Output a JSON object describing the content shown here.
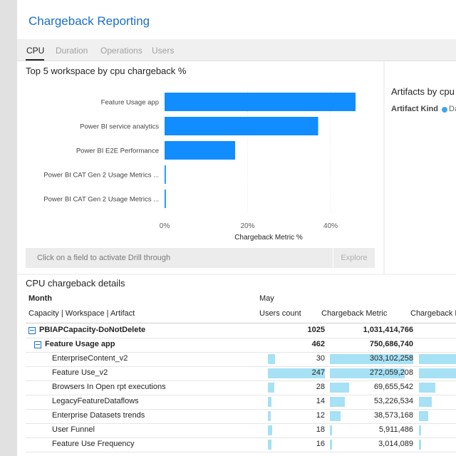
{
  "app": {
    "title": "Chargeback Reporting"
  },
  "tabs": [
    {
      "label": "CPU",
      "active": true
    },
    {
      "label": "Duration",
      "active": false
    },
    {
      "label": "Operations",
      "active": false
    },
    {
      "label": "Users",
      "active": false
    }
  ],
  "top5": {
    "title": "Top 5 workspace by cpu chargeback %",
    "drill_text": "Click on a field to activate Drill through",
    "explore_label": "Explore"
  },
  "chart_data": {
    "type": "bar",
    "orientation": "horizontal",
    "title": "Top 5 workspace by cpu chargeback %",
    "categories": [
      "Feature Usage app",
      "Power BI service analytics",
      "Power BI E2E Performance",
      "Power BI CAT Gen 2 Usage Metrics ...",
      "Power BI CAT Gen 2 Usage Metrics ..."
    ],
    "values": [
      46,
      37,
      17,
      0.3,
      0.3
    ],
    "xlabel": "Chargeback Metric %",
    "xlim": [
      0,
      46
    ],
    "ticks": [
      "0%",
      "20%",
      "40%"
    ],
    "tick_values": [
      0,
      20,
      40
    ],
    "color": "#118dff"
  },
  "artifacts": {
    "title": "Artifacts by cpu",
    "kind_label": "Artifact Kind",
    "legend_text": "Da"
  },
  "details": {
    "title": "CPU chargeback details",
    "row_header_1": "Month",
    "row_header_2": "Capacity | Workspace | Artifact",
    "month": "May",
    "col_users": "Users count",
    "col_metric": "Chargeback Metric",
    "col_metric2": "Chargeback M",
    "bar_color": "#a6e1f5",
    "rows": [
      {
        "name": "PBIAPCapacity-DoNotDelete",
        "users": "1025",
        "metric": "1,031,414,766",
        "level": 0,
        "bold": true,
        "expander": true,
        "users_frac": 0,
        "metric_frac": 0,
        "metric2_frac": 0
      },
      {
        "name": "Feature Usage app",
        "users": "462",
        "metric": "750,686,740",
        "level": 1,
        "bold": true,
        "expander": true,
        "users_frac": 0,
        "metric_frac": 0,
        "metric2_frac": 0
      },
      {
        "name": "EnterpriseContent_v2",
        "users": "30",
        "metric": "303,102,258",
        "level": 2,
        "bold": false,
        "expander": false,
        "users_frac": 0.121,
        "metric_frac": 1.0,
        "metric2_frac": 1.0
      },
      {
        "name": "Feature Use_v2",
        "users": "247",
        "metric": "272,059,208",
        "level": 2,
        "bold": false,
        "expander": false,
        "users_frac": 1.0,
        "metric_frac": 0.898,
        "metric2_frac": 1.0
      },
      {
        "name": "Browsers In Open rpt executions",
        "users": "28",
        "metric": "69,655,542",
        "level": 2,
        "bold": false,
        "expander": false,
        "users_frac": 0.113,
        "metric_frac": 0.23,
        "metric2_frac": 0.45
      },
      {
        "name": "LegacyFeatureDataflows",
        "users": "14",
        "metric": "53,226,534",
        "level": 2,
        "bold": false,
        "expander": false,
        "users_frac": 0.057,
        "metric_frac": 0.176,
        "metric2_frac": 0.35
      },
      {
        "name": "Enterprise Datasets trends",
        "users": "12",
        "metric": "38,573,168",
        "level": 2,
        "bold": false,
        "expander": false,
        "users_frac": 0.049,
        "metric_frac": 0.127,
        "metric2_frac": 0.25
      },
      {
        "name": "User Funnel",
        "users": "18",
        "metric": "5,911,486",
        "level": 2,
        "bold": false,
        "expander": false,
        "users_frac": 0.073,
        "metric_frac": 0.02,
        "metric2_frac": 0.04
      },
      {
        "name": "Feature Use Frequency",
        "users": "16",
        "metric": "3,014,089",
        "level": 2,
        "bold": false,
        "expander": false,
        "users_frac": 0.065,
        "metric_frac": 0.01,
        "metric2_frac": 0.02
      }
    ]
  }
}
